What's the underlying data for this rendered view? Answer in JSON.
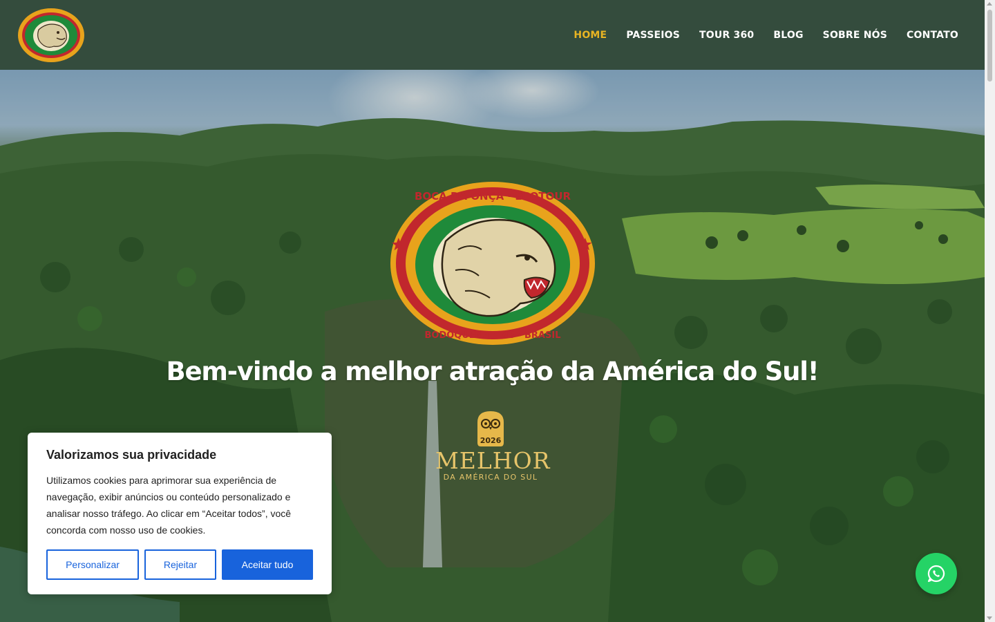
{
  "brand": {
    "logo_alt": "Boca da Onça Ecotour",
    "logo_text_top": "BOCA DA ONÇA · ECOTOUR",
    "logo_text_bottom": "BODOQUENA · MS · BRASIL"
  },
  "nav": {
    "items": [
      {
        "label": "HOME",
        "active": true
      },
      {
        "label": "PASSEIOS",
        "active": false
      },
      {
        "label": "TOUR 360",
        "active": false
      },
      {
        "label": "BLOG",
        "active": false
      },
      {
        "label": "SOBRE NÓS",
        "active": false
      },
      {
        "label": "CONTATO",
        "active": false
      }
    ],
    "active_color": "#e8b423"
  },
  "hero": {
    "headline": "Bem-vindo a melhor atração da América do Sul!",
    "award": {
      "year": "2026",
      "title": "MELHOR",
      "subtitle": "DA AMÉRICA DO SUL"
    }
  },
  "cookie": {
    "title": "Valorizamos sua privacidade",
    "text": "Utilizamos cookies para aprimorar sua experiência de navegação, exibir anúncios ou conteúdo personalizado e analisar nosso tráfego. Ao clicar em “Aceitar todos”, você concorda com nosso uso de cookies.",
    "buttons": {
      "customize": "Personalizar",
      "reject": "Rejeitar",
      "accept": "Aceitar tudo"
    },
    "accent_color": "#1863dc"
  },
  "whatsapp": {
    "icon": "whatsapp-icon",
    "color": "#25d366"
  },
  "colors": {
    "header_bg": "#344c3d"
  }
}
